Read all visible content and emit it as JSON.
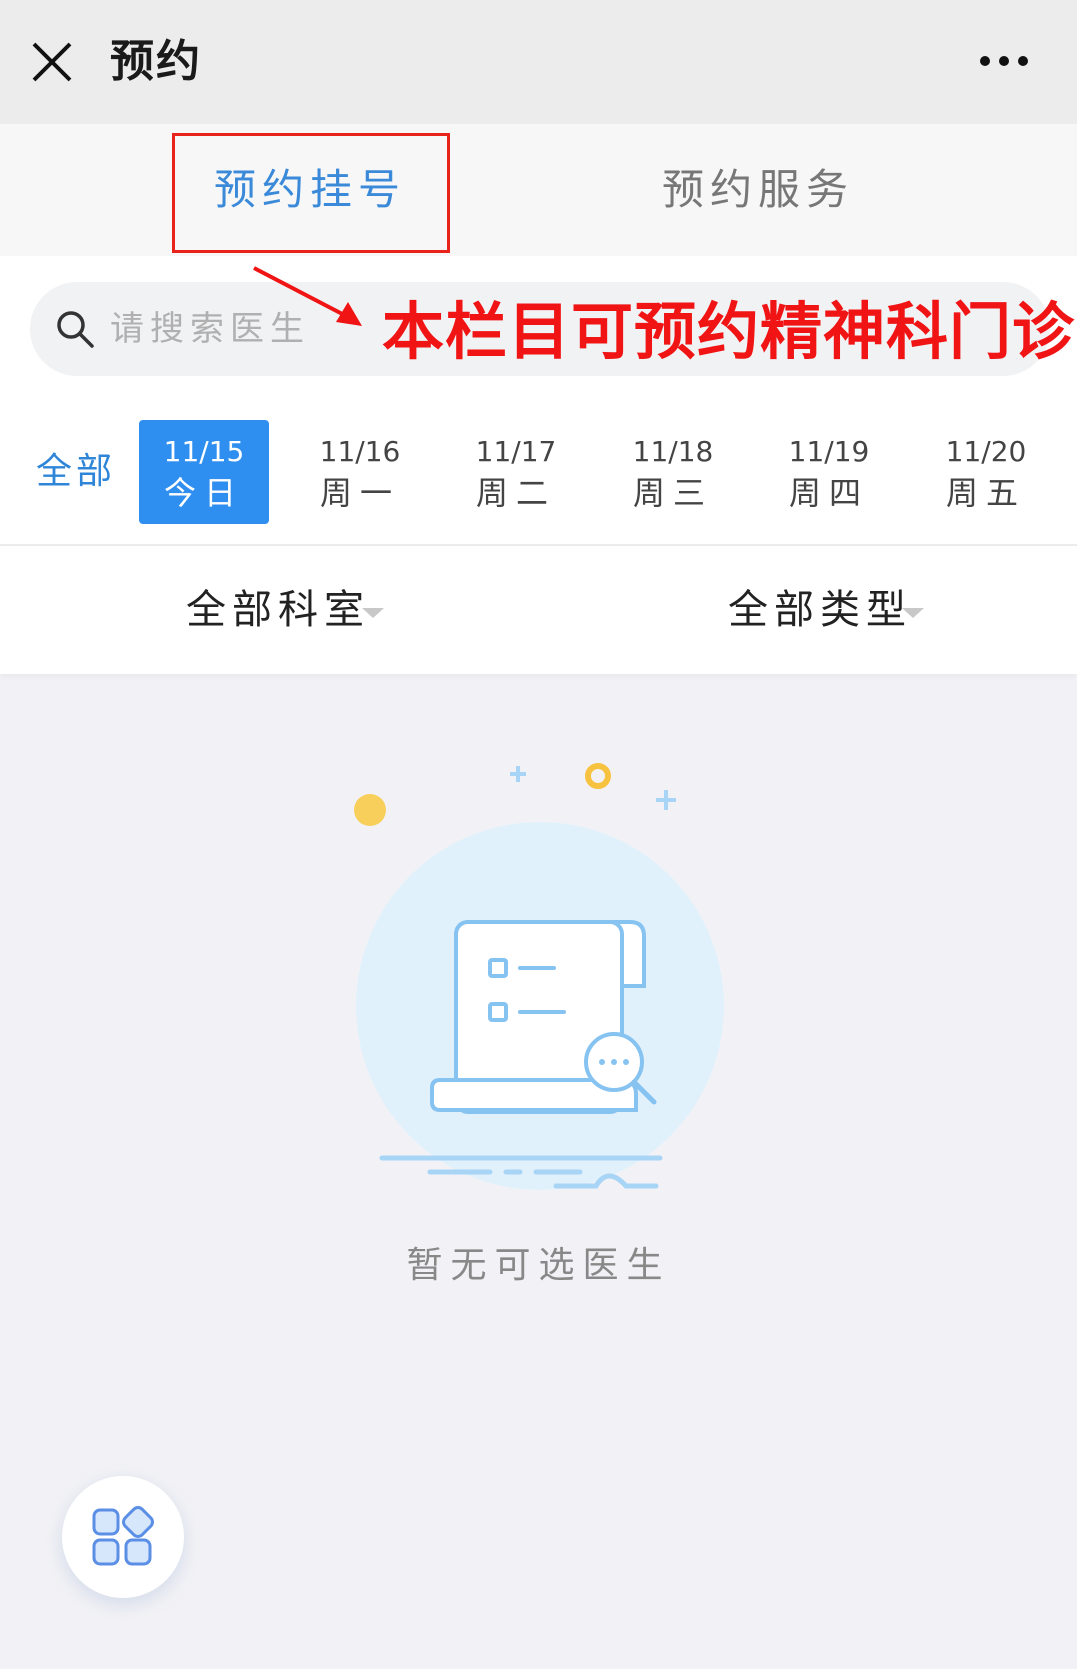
{
  "titlebar": {
    "title": "预约",
    "close_icon": "close-icon",
    "more_icon": "more-horizontal-icon"
  },
  "tabs": [
    {
      "label": "预约挂号",
      "active": true
    },
    {
      "label": "预约服务",
      "active": false
    }
  ],
  "annotation": {
    "text": "本栏目可预约精神科门诊",
    "color": "#f01414"
  },
  "search": {
    "placeholder": "请搜索医生",
    "icon": "search-icon"
  },
  "dates": {
    "all_label": "全部",
    "items": [
      {
        "date": "11/15",
        "day": "今日",
        "active": true
      },
      {
        "date": "11/16",
        "day": "周一",
        "active": false
      },
      {
        "date": "11/17",
        "day": "周二",
        "active": false
      },
      {
        "date": "11/18",
        "day": "周三",
        "active": false
      },
      {
        "date": "11/19",
        "day": "周四",
        "active": false
      },
      {
        "date": "11/20",
        "day": "周五",
        "active": false
      }
    ]
  },
  "filters": {
    "department": "全部科室",
    "type": "全部类型"
  },
  "empty_state": {
    "message": "暂无可选医生",
    "illustration": "empty-document-search-icon"
  },
  "fab": {
    "icon": "apps-grid-icon"
  },
  "colors": {
    "accent": "#2f8ff0",
    "tab_active": "#3b8ad9",
    "annotation_red": "#f01414"
  }
}
